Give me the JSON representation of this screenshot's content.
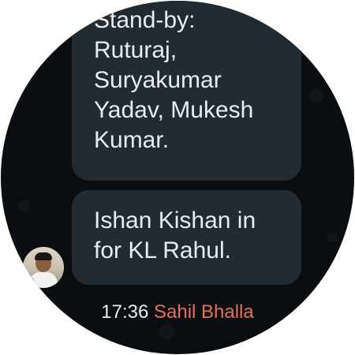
{
  "messages": [
    {
      "text": "Stand-by:\nRuturaj,\nSuryakumar\nYadav, Mukesh\nKumar."
    },
    {
      "text": "Ishan Kishan in\nfor KL Rahul."
    }
  ],
  "footer": {
    "time": "17:36",
    "sender": "Sahil Bhalla"
  },
  "colors": {
    "background": "#0b0e10",
    "bubble": "#222b31",
    "text": "#e9edef",
    "sender": "#e5705a"
  }
}
